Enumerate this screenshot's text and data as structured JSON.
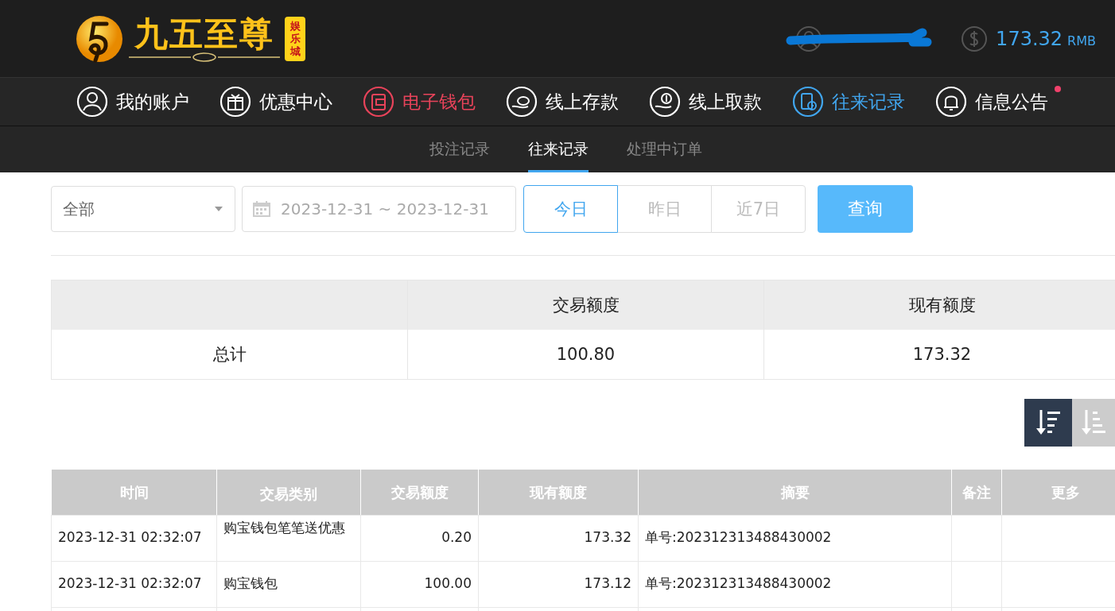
{
  "header": {
    "logo": {
      "name": "九五至尊",
      "tag": "娱乐城"
    },
    "balance": {
      "amount": "173.32",
      "currency": "RMB"
    }
  },
  "nav": [
    {
      "label": "我的账户",
      "color": "#ffffff"
    },
    {
      "label": "优惠中心",
      "color": "#ffffff"
    },
    {
      "label": "电子钱包",
      "color": "#e8435a"
    },
    {
      "label": "线上存款",
      "color": "#ffffff"
    },
    {
      "label": "线上取款",
      "color": "#ffffff"
    },
    {
      "label": "往来记录",
      "color": "#41a6ef"
    },
    {
      "label": "信息公告",
      "color": "#ffffff",
      "badge_dot": true
    }
  ],
  "subnav": [
    {
      "label": "投注记录",
      "selected": false
    },
    {
      "label": "往来记录",
      "selected": true
    },
    {
      "label": "处理中订单",
      "selected": false
    }
  ],
  "filters": {
    "type_select": "全部",
    "date_range": "2023-12-31 ~ 2023-12-31",
    "quick_dates": [
      {
        "label": "今日",
        "selected": true
      },
      {
        "label": "昨日",
        "selected": false
      },
      {
        "label": "近7日",
        "selected": false
      }
    ],
    "query_button": "查询"
  },
  "summary": {
    "columns": [
      "交易额度",
      "现有额度"
    ],
    "row": {
      "label": "总计",
      "values": [
        "100.80",
        "173.32"
      ]
    }
  },
  "sort_buttons": [
    {
      "selected": true
    },
    {
      "selected": false
    }
  ],
  "table": {
    "columns": [
      "时间",
      "交易类别",
      "交易额度",
      "现有额度",
      "摘要",
      "备注",
      "更多"
    ],
    "rows": [
      [
        "2023-12-31 02:32:07",
        "购宝钱包笔笔送优惠",
        "0.20",
        "173.32",
        "单号:202312313488430002",
        "",
        ""
      ],
      [
        "2023-12-31 02:32:07",
        "购宝钱包",
        "100.00",
        "173.12",
        "单号:202312313488430002",
        "",
        ""
      ]
    ]
  }
}
